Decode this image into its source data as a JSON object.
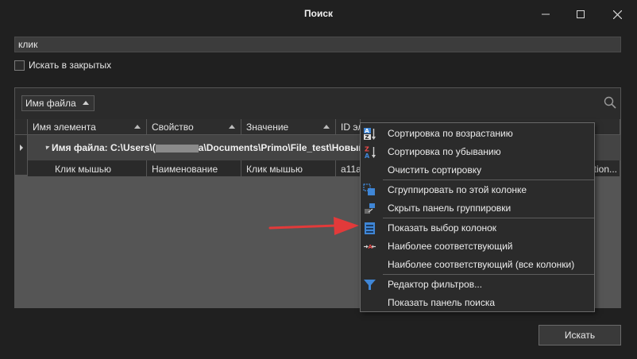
{
  "window": {
    "title": "Поиск"
  },
  "search": {
    "value": "клик",
    "closed_label": "Искать в закрытых"
  },
  "panel": {
    "field_selector": "Имя файла"
  },
  "grid": {
    "columns": [
      "Имя элемента",
      "Свойство",
      "Значение",
      "ID эл"
    ],
    "group_row": {
      "prefix": "Имя файла: C:\\Users\\",
      "masked": "(",
      "suffix": "a\\Documents\\Primo\\File_test\\Новый"
    },
    "row": {
      "cells": [
        "Клик мышью",
        "Наименование",
        "Клик мышью",
        "a11a"
      ],
      "tail": "tion..."
    }
  },
  "context_menu": {
    "items": [
      {
        "label": "Сортировка по возрастанию",
        "icon": "sort-ascending-icon"
      },
      {
        "label": "Сортировка по убыванию",
        "icon": "sort-descending-icon"
      },
      {
        "label": "Очистить сортировку",
        "icon": ""
      },
      {
        "label": "Сгруппировать по этой колонке",
        "icon": "group-by-column-icon"
      },
      {
        "label": "Скрыть панель группировки",
        "icon": "hide-group-panel-icon"
      },
      {
        "label": "Показать выбор колонок",
        "icon": "column-chooser-icon"
      },
      {
        "label": "Наиболее соответствующий",
        "icon": "best-fit-icon"
      },
      {
        "label": "Наиболее соответствующий (все колонки)",
        "icon": ""
      },
      {
        "label": "Редактор фильтров...",
        "icon": "filter-icon"
      },
      {
        "label": "Показать панель поиска",
        "icon": ""
      }
    ]
  },
  "buttons": {
    "find": "Искать"
  },
  "colors": {
    "background": "#202020",
    "menu_icon_blue": "#3f86d6",
    "annotation_arrow": "#e23a3a"
  }
}
